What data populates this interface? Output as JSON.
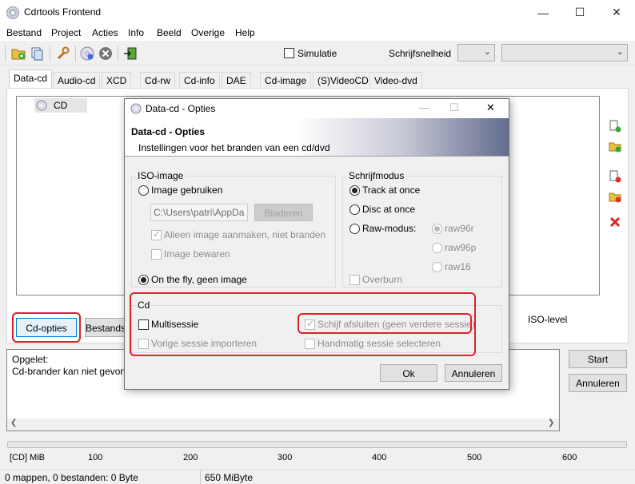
{
  "window": {
    "title": "Cdrtools Frontend"
  },
  "menu": [
    "Bestand",
    "Project",
    "Acties",
    "Info",
    "Beeld",
    "Overige",
    "Help"
  ],
  "toolbar": {
    "simulatie": "Simulatie",
    "schrijfsnelheid": "Schrijfsnelheid"
  },
  "tabs": [
    "Data-cd",
    "Audio-cd",
    "XCD",
    "Cd-rw",
    "Cd-info",
    "DAE",
    "Cd-image",
    "(S)VideoCD",
    "Video-dvd"
  ],
  "tree": {
    "root": "CD"
  },
  "main": {
    "cd_opties": "Cd-opties",
    "bestands": "Bestands",
    "iso_level": "ISO-level"
  },
  "log": {
    "line1": "Opgelet:",
    "line2": "Cd-brander kan niet gevon"
  },
  "actions": {
    "start": "Start",
    "annuleren": "Annuleren"
  },
  "ruler": {
    "unit": "[CD] MiB",
    "ticks": [
      "100",
      "200",
      "300",
      "400",
      "500",
      "600"
    ]
  },
  "status": {
    "left": "0 mappen, 0 bestanden: 0 Byte",
    "right": "650 MiByte"
  },
  "dialog": {
    "title": "Data-cd - Opties",
    "header_title": "Data-cd - Opties",
    "header_sub": "Instellingen voor het branden van een cd/dvd",
    "iso": {
      "legend": "ISO-image",
      "use_image": "Image gebruiken",
      "path": "C:\\Users\\patri\\AppDa",
      "browse": "Bladeren",
      "only_create": "Alleen image aanmaken, niet branden",
      "keep": "Image bewaren",
      "on_the_fly": "On the fly, geen image"
    },
    "write": {
      "legend": "Schrijfmodus",
      "tao": "Track at once",
      "dao": "Disc at once",
      "raw": "Raw-modus:",
      "raw96r": "raw96r",
      "raw96p": "raw96p",
      "raw16": "raw16",
      "overburn": "Overburn"
    },
    "cd": {
      "legend": "Cd",
      "multisessie": "Multisessie",
      "vorige": "Vorige sessie importeren",
      "afsluiten": "Schijf afsluiten (geen verdere sessie)",
      "handmatig": "Handmatig sessie selecteren"
    },
    "ok": "Ok",
    "annuleren": "Annuleren"
  }
}
